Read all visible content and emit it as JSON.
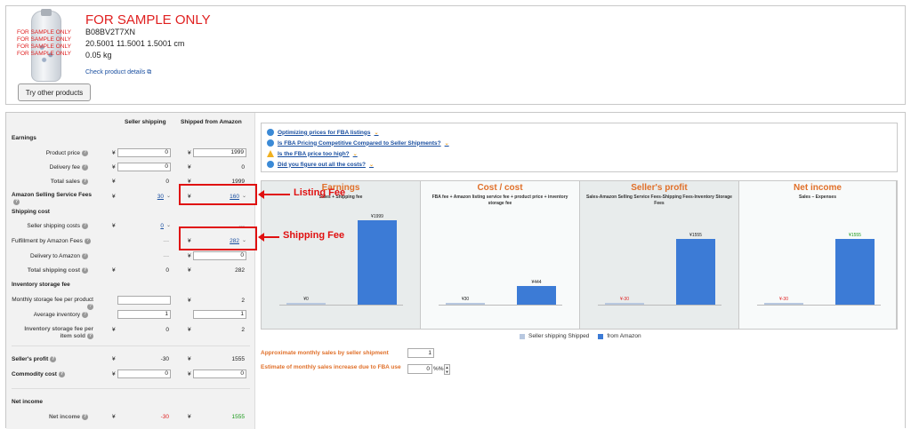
{
  "product": {
    "watermark": "FOR SAMPLE ONLY",
    "title": "FOR SAMPLE ONLY",
    "asin": "B08BV2T7XN",
    "dimensions": "20.5001 11.5001 1.5001 cm",
    "weight": "0.05 kg",
    "details_link": "Check product details",
    "try_button": "Try other products"
  },
  "columns": {
    "seller": "Seller shipping",
    "amazon": "Shipped from Amazon"
  },
  "currency": "¥",
  "sections": {
    "earnings": "Earnings",
    "shipping_cost": "Shipping cost",
    "inventory": "Inventory storage fee",
    "net_income": "Net income"
  },
  "rows": {
    "product_price": {
      "label": "Product price",
      "seller": "0",
      "amazon": "1999"
    },
    "delivery_fee": {
      "label": "Delivery fee",
      "seller": "0",
      "amazon": "0"
    },
    "total_sales": {
      "label": "Total sales",
      "seller": "0",
      "amazon": "1999"
    },
    "selling_fee": {
      "label": "Amazon Selling Service Fees",
      "seller": "30",
      "amazon": "160"
    },
    "seller_shipping": {
      "label": "Seller shipping costs",
      "seller": "0",
      "amazon": "---"
    },
    "fba_fee": {
      "label": "Fulfillment by Amazon Fees",
      "seller": "---",
      "amazon": "282"
    },
    "delivery_amazon": {
      "label": "Delivery to Amazon",
      "seller": "---",
      "amazon": "0"
    },
    "total_shipping": {
      "label": "Total shipping cost",
      "seller": "0",
      "amazon": "282"
    },
    "monthly_storage": {
      "label": "Monthly storage fee per product",
      "seller": "",
      "amazon": "2"
    },
    "avg_inventory": {
      "label": "Average inventory",
      "seller": "1",
      "amazon": "1"
    },
    "inv_per_item": {
      "label": "Inventory storage fee per item sold",
      "seller": "0",
      "amazon": "2"
    },
    "seller_profit": {
      "label": "Seller's profit",
      "seller": "-30",
      "amazon": "1555"
    },
    "commodity_cost": {
      "label": "Commodity cost",
      "seller": "0",
      "amazon": "0"
    },
    "net_income": {
      "label": "Net income",
      "seller": "-30",
      "amazon": "1555"
    }
  },
  "tips": [
    "Optimizing prices for FBA listings",
    "Is FBA Pricing Competitive Compared to Seller Shipments?",
    "Is the FBA price too high?",
    "Did you figure out all the costs?"
  ],
  "chart_data": [
    {
      "type": "bar",
      "title": "Earnings",
      "subtitle": "Sales + Shipping fee",
      "categories": [
        "Seller shipping Shipped",
        "from Amazon"
      ],
      "values": [
        0,
        1999
      ],
      "labels": [
        "¥0",
        "¥1999"
      ]
    },
    {
      "type": "bar",
      "title": "Cost / cost",
      "subtitle": "FBA fee + Amazon listing service fee + product price + inventory storage fee",
      "categories": [
        "Seller shipping Shipped",
        "from Amazon"
      ],
      "values": [
        30,
        444
      ],
      "labels": [
        "¥30",
        "¥444"
      ]
    },
    {
      "type": "bar",
      "title": "Seller's profit",
      "subtitle": "Sales-Amazon Selling Service Fees-Shipping Fees-Inventory Storage Fees",
      "categories": [
        "Seller shipping Shipped",
        "from Amazon"
      ],
      "values": [
        -30,
        1555
      ],
      "labels": [
        "¥-30",
        "¥1555"
      ]
    },
    {
      "type": "bar",
      "title": "Net income",
      "subtitle": "Sales – Expenses",
      "categories": [
        "Seller shipping Shipped",
        "from Amazon"
      ],
      "values": [
        -30,
        1555
      ],
      "labels": [
        "¥-30",
        "¥1555"
      ]
    }
  ],
  "legend": {
    "seller": "Seller shipping Shipped",
    "amazon": "from Amazon"
  },
  "estimates": {
    "monthly_sales_label": "Approximate monthly sales by seller shipment",
    "monthly_sales_value": "1",
    "increase_label": "Estimate of monthly sales increase due to FBA use",
    "increase_value": "0",
    "increase_unit": "%%"
  },
  "annotations": {
    "listing_fee": "Listing Fee",
    "shipping_fee": "Shipping Fee"
  },
  "colors": {
    "bar": "#3c7bd6",
    "bar_light": "#b8c8e0",
    "title": "#e0702a",
    "annotation": "#e01010"
  }
}
